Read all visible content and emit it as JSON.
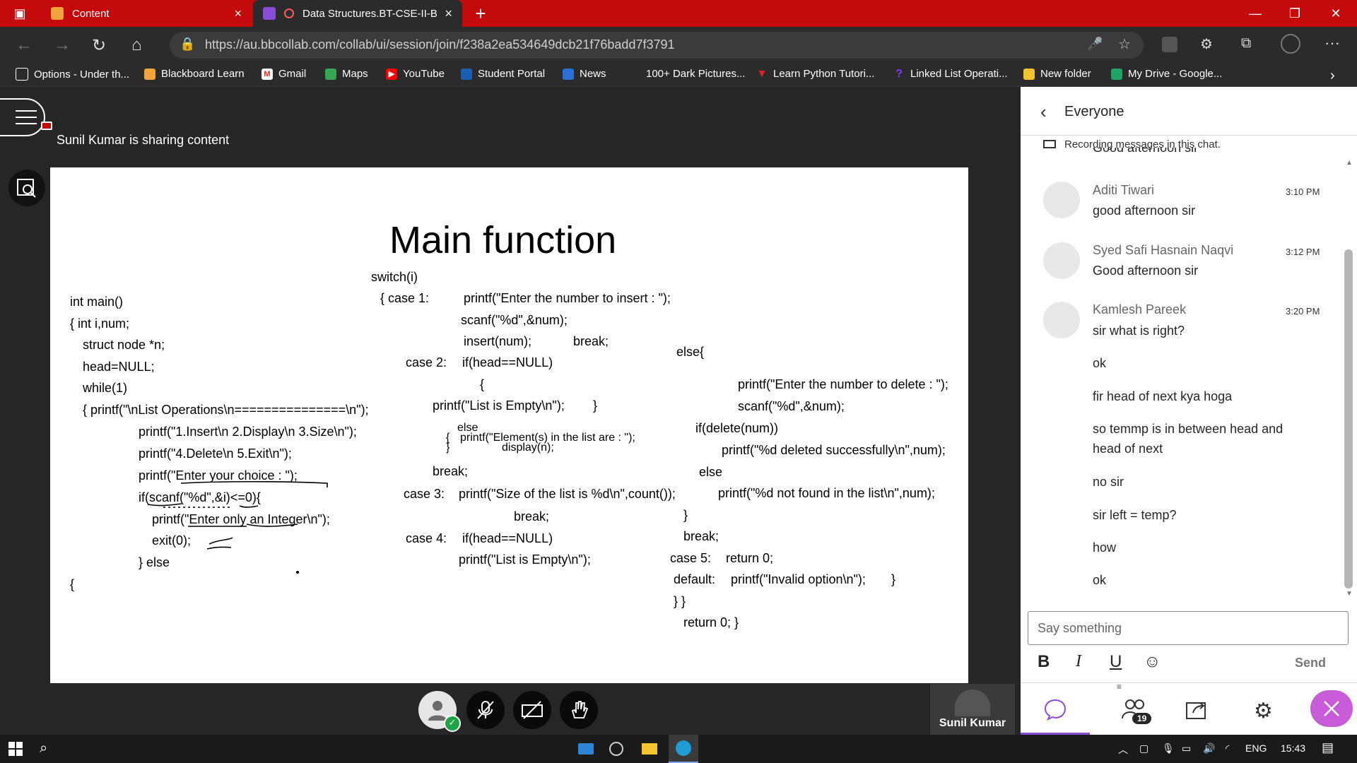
{
  "browser": {
    "tabs": [
      {
        "title": "Content"
      },
      {
        "title": "Data Structures.BT-CSE-II-B"
      }
    ],
    "new_tab": "+",
    "url": "https://au.bbcollab.com/collab/ui/session/join/f238a2ea534649dcb21f76badd7f3791",
    "bookmarks": [
      "Options - Under th...",
      "Blackboard Learn",
      "Gmail",
      "Maps",
      "YouTube",
      "Student Portal",
      "News",
      "100+ Dark Pictures...",
      "Learn Python Tutori...",
      "Linked List Operati...",
      "New folder",
      "My Drive - Google..."
    ]
  },
  "session": {
    "share_status": "Sunil Kumar is sharing content",
    "presenter_name": "Sunil Kumar"
  },
  "slide": {
    "title": "Main function",
    "col1": [
      "int  main()",
      "{  int i,num;",
      "struct node *n;",
      "head=NULL;",
      "while(1)",
      "{    printf(\"\\nList Operations\\n===============\\n\");",
      "printf(\"1.Insert\\n 2.Display\\n 3.Size\\n\");",
      "printf(\"4.Delete\\n 5.Exit\\n\");",
      "printf(\"Enter your choice : \");",
      "if(scanf(\"%d\",&i)<=0){",
      "printf(\"Enter only an Integer\\n\");",
      "exit(0);",
      "} else",
      "{"
    ],
    "col2": [
      "switch(i)",
      "{     case 1:",
      "printf(\"Enter the number to insert : \");",
      "scanf(\"%d\",&num);",
      "insert(num);",
      "break;",
      "case 2:",
      "if(head==NULL)",
      "{",
      "printf(\"List is Empty\\n\");",
      "}",
      "else",
      "{",
      "printf(\"Element(s) in the list are : \");",
      "}",
      "display(n);",
      "break;",
      "case 3:",
      "printf(\"Size of the list is %d\\n\",count());",
      "break;",
      "case 4:",
      "if(head==NULL)",
      "printf(\"List is Empty\\n\");"
    ],
    "col3": [
      "else{",
      "printf(\"Enter the number to delete : \");",
      "scanf(\"%d\",&num);",
      "if(delete(num))",
      "printf(\"%d deleted successfully\\n\",num);",
      "else",
      "printf(\"%d not found in the list\\n\",num);",
      "}",
      "break;",
      "case 5:",
      "return 0;",
      "default:",
      "printf(\"Invalid option\\n\");",
      "}",
      "}  }",
      "return 0;  }"
    ]
  },
  "chat": {
    "title": "Everyone",
    "recording_note": "Recording messages in this chat.",
    "cut_off": "Good afternoon sir",
    "messages": [
      {
        "name": "Aditi Tiwari",
        "time": "3:10 PM",
        "text": "good afternoon sir"
      },
      {
        "name": "Syed Safi Hasnain Naqvi",
        "time": "3:12 PM",
        "text": "Good afternoon sir"
      },
      {
        "name": "Kamlesh Pareek",
        "time": "3:20 PM",
        "text": "sir what is right?"
      }
    ],
    "followups": [
      "ok",
      "fir head of next kya hoga",
      "so temmp is in between head and head of next",
      "no sir",
      "sir left = temp?",
      "how",
      "ok"
    ],
    "input_placeholder": "Say something",
    "format": {
      "bold": "B",
      "italic": "I",
      "underline": "U"
    },
    "send_label": "Send",
    "attendee_count": "19"
  },
  "taskbar": {
    "language": "ENG",
    "time": "15:43"
  }
}
